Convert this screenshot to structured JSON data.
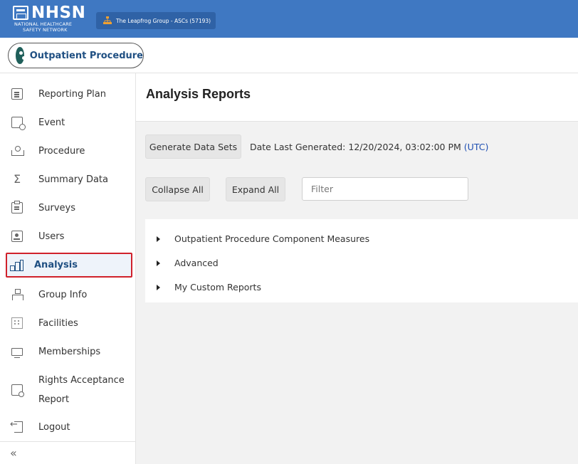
{
  "header": {
    "logo_word": "NHSN",
    "logo_sub_line1": "NATIONAL HEALTHCARE",
    "logo_sub_line2": "SAFETY NETWORK",
    "group_label": "The Leapfrog Group - ASCs (57193)"
  },
  "component": {
    "label": "Outpatient Procedure"
  },
  "sidebar": {
    "items": [
      {
        "label": "Reporting Plan",
        "icon": "reporting-plan-icon"
      },
      {
        "label": "Event",
        "icon": "event-icon"
      },
      {
        "label": "Procedure",
        "icon": "procedure-icon"
      },
      {
        "label": "Summary Data",
        "icon": "sigma-icon"
      },
      {
        "label": "Surveys",
        "icon": "clipboard-icon"
      },
      {
        "label": "Users",
        "icon": "user-badge-icon"
      },
      {
        "label": "Analysis",
        "icon": "bar-chart-icon",
        "active": true
      },
      {
        "label": "Group Info",
        "icon": "hierarchy-icon"
      },
      {
        "label": "Facilities",
        "icon": "building-icon"
      },
      {
        "label": "Memberships",
        "icon": "monitor-icon"
      },
      {
        "label_line1": "Rights Acceptance",
        "label_line2": "Report",
        "icon": "document-search-icon"
      },
      {
        "label": "Logout",
        "icon": "logout-icon"
      }
    ],
    "collapse_glyph": "«"
  },
  "main": {
    "title": "Analysis Reports",
    "generate_button": "Generate Data Sets",
    "date_label": "Date Last Generated: 12/20/2024, 03:02:00 PM",
    "timezone": "(UTC)",
    "collapse_all": "Collapse All",
    "expand_all": "Expand All",
    "filter_placeholder": "Filter",
    "tree": [
      "Outpatient Procedure Component Measures",
      "Advanced",
      "My Custom Reports"
    ]
  },
  "colors": {
    "header_blue": "#3f78c2",
    "active_border": "#d0212b",
    "link_blue": "#1f4fb2",
    "nav_active_text": "#1f4f82"
  }
}
